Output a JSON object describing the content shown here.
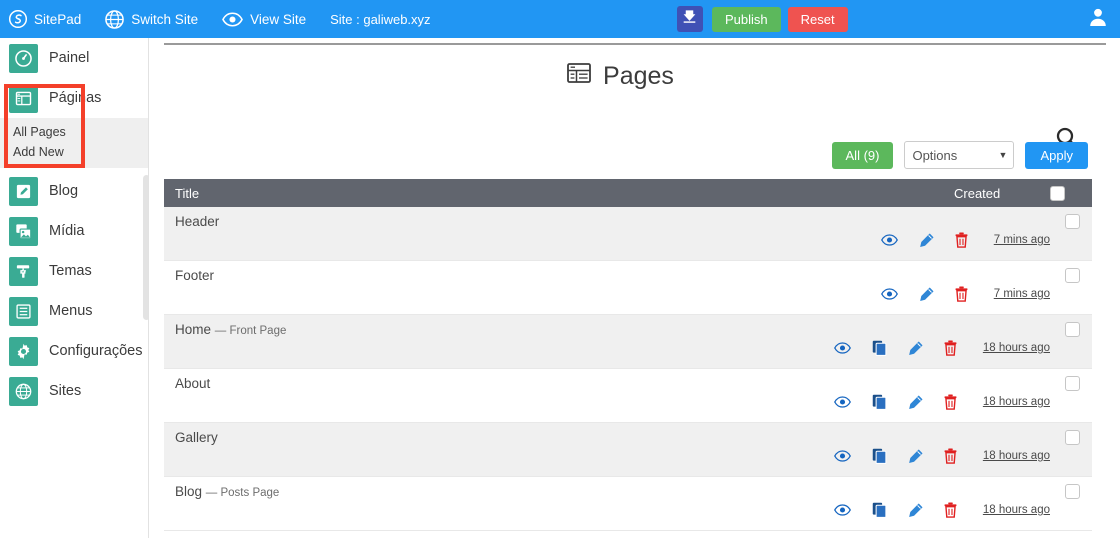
{
  "topbar": {
    "brand": "SitePad",
    "brand_icon": "sitepad-logo-icon",
    "switch_site": "Switch Site",
    "switch_site_icon": "globe-icon",
    "view_site": "View Site",
    "view_site_icon": "eye-icon",
    "site_label": "Site : galiweb.xyz",
    "save_icon": "download-save-icon",
    "publish_label": "Publish",
    "reset_label": "Reset",
    "avatar_icon": "user-avatar-icon",
    "bg_color": "#2196f3",
    "publish_color": "#5cb85c",
    "reset_color": "#ef5350",
    "save_color": "#3f51b5"
  },
  "sidebar": {
    "accent_color": "#3aab94",
    "highlight_color": "#f4402a",
    "items": [
      {
        "label": "Painel",
        "icon": "dashboard-icon"
      },
      {
        "label": "Páginas",
        "icon": "pages-icon"
      },
      {
        "label": "Blog",
        "icon": "pencil-square-icon"
      },
      {
        "label": "Mídia",
        "icon": "media-images-icon"
      },
      {
        "label": "Temas",
        "icon": "paint-roller-icon"
      },
      {
        "label": "Menus",
        "icon": "list-icon"
      },
      {
        "label": "Configurações",
        "icon": "gear-icon"
      },
      {
        "label": "Sites",
        "icon": "globe-icon"
      }
    ],
    "submenu": [
      {
        "label": "All Pages"
      },
      {
        "label": "Add New"
      }
    ]
  },
  "main": {
    "title": "Pages",
    "title_icon": "table-grid-icon",
    "search_icon": "search-icon",
    "filter": {
      "all_label": "All (9)",
      "options_value": "Options",
      "options_caret": "chevron-down-icon",
      "apply_label": "Apply",
      "all_color": "#5cb85c",
      "apply_color": "#2196f3"
    },
    "table": {
      "header_bg": "#61656e",
      "columns": {
        "title": "Title",
        "created": "Created"
      },
      "icons": {
        "view": "eye-icon",
        "duplicate": "copy-duplicate-icon",
        "edit": "pencil-edit-icon",
        "delete": "trash-delete-icon"
      },
      "rows": [
        {
          "title": "Header",
          "badge": "",
          "created": "7 mins ago",
          "has_duplicate": false,
          "shaded": true
        },
        {
          "title": "Footer",
          "badge": "",
          "created": "7 mins ago",
          "has_duplicate": false,
          "shaded": false
        },
        {
          "title": "Home",
          "badge": "— Front Page",
          "created": "18 hours ago",
          "has_duplicate": true,
          "shaded": true
        },
        {
          "title": "About",
          "badge": "",
          "created": "18 hours ago",
          "has_duplicate": true,
          "shaded": false
        },
        {
          "title": "Gallery",
          "badge": "",
          "created": "18 hours ago",
          "has_duplicate": true,
          "shaded": true
        },
        {
          "title": "Blog",
          "badge": "— Posts Page",
          "created": "18 hours ago",
          "has_duplicate": true,
          "shaded": false
        }
      ]
    }
  }
}
